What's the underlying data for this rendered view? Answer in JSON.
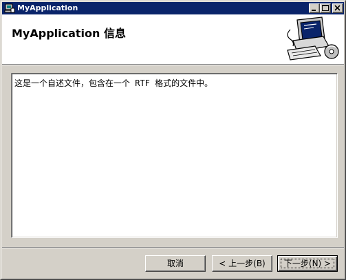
{
  "window": {
    "title": "MyApplication",
    "icons": {
      "app": "installer-icon",
      "minimize": "minimize-icon",
      "maximize": "maximize-icon",
      "close": "close-icon"
    }
  },
  "header": {
    "title": "MyApplication 信息",
    "art": "computer-setup-icon"
  },
  "content": {
    "text": "这是一个自述文件，包含在一个 RTF 格式的文件中。"
  },
  "buttons": {
    "cancel_label": "取消",
    "back_label": "< 上一步(B)",
    "next_label": "下一步(N) >"
  },
  "colors": {
    "titlebar": "#0a246a",
    "face": "#d4d0c8",
    "header_bg": "#ffffff"
  }
}
